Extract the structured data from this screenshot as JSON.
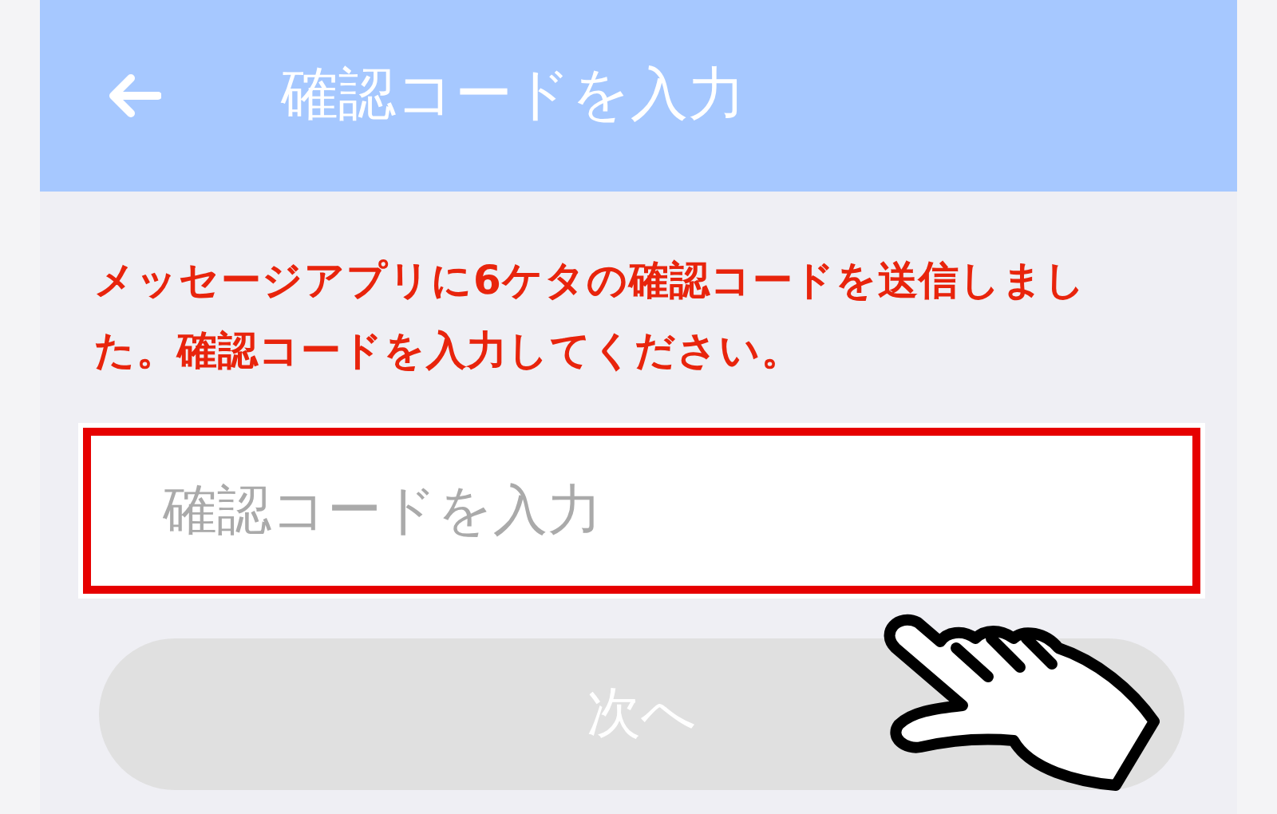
{
  "header": {
    "title": "確認コードを入力"
  },
  "message": "メッセージアプリに6ケタの確認コードを送信しました。確認コードを入力してください。",
  "code_field": {
    "placeholder": "確認コードを入力",
    "highlighted": true
  },
  "next_button": {
    "label": "次へ",
    "disabled": true
  }
}
